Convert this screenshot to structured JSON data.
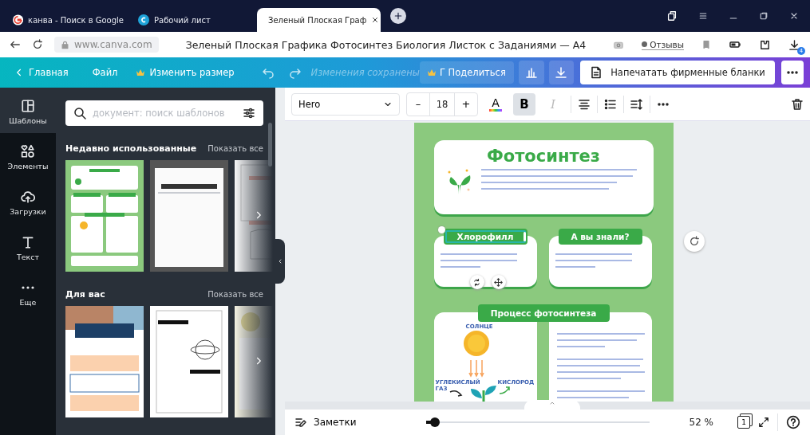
{
  "browser_tabs": [
    {
      "kind": "google",
      "title": "канва - Поиск в Google",
      "selected": false
    },
    {
      "kind": "canva",
      "title": "Рабочий лист",
      "selected": false
    },
    {
      "kind": "canva",
      "title": "Зеленый Плоская Граф",
      "selected": true
    }
  ],
  "address_bar": {
    "url": "www.canva.com",
    "page_title": "Зеленый Плоская Графика Фотосинтез Биология Листок с Заданиями — A4",
    "feedback": "Отзывы",
    "downloads_badge": "4"
  },
  "editor_menu": {
    "home": "Главная",
    "file": "Файл",
    "resize": "Изменить размер",
    "save_status": "Изменения сохранены",
    "share": "Г Поделиться",
    "print": "Напечатать фирменные бланки"
  },
  "side_rail": [
    {
      "kind": "templates",
      "label": "Шаблоны",
      "selected": true
    },
    {
      "kind": "elements",
      "label": "Элементы",
      "selected": false
    },
    {
      "kind": "uploads",
      "label": "Загрузки",
      "selected": false
    },
    {
      "kind": "text",
      "label": "Текст",
      "selected": false
    },
    {
      "kind": "more",
      "label": "Еще",
      "selected": false
    }
  ],
  "search": {
    "placeholder": "документ: поиск шаблонов"
  },
  "sections": [
    {
      "title": "Недавно использованные",
      "link": "Показать все"
    },
    {
      "title": "Для вас",
      "link": "Показать все"
    }
  ],
  "text_toolbar": {
    "font": "Hero",
    "size": "18",
    "minus": "–",
    "plus": "+",
    "color_letter": "A",
    "bold": {
      "letter": "B",
      "on": true
    },
    "italic": {
      "letter": "I",
      "disabled": true
    }
  },
  "design": {
    "title": "Фотосинтез",
    "cards": [
      {
        "heading": "Хлорофилл",
        "selected": true
      },
      {
        "heading": "А вы знали?",
        "selected": false
      }
    ],
    "process_heading": "Процесс фотосинтеза",
    "sun_label": "СОЛНЦЕ",
    "co2_label": "УГЛЕКИСЛЫЙ ГАЗ",
    "oxygen_label": "КИСЛОРОД"
  },
  "status_bar": {
    "notes": "Заметки",
    "zoom": {
      "level": 0.04
    },
    "zoom_value": "52 %",
    "page": "1"
  }
}
